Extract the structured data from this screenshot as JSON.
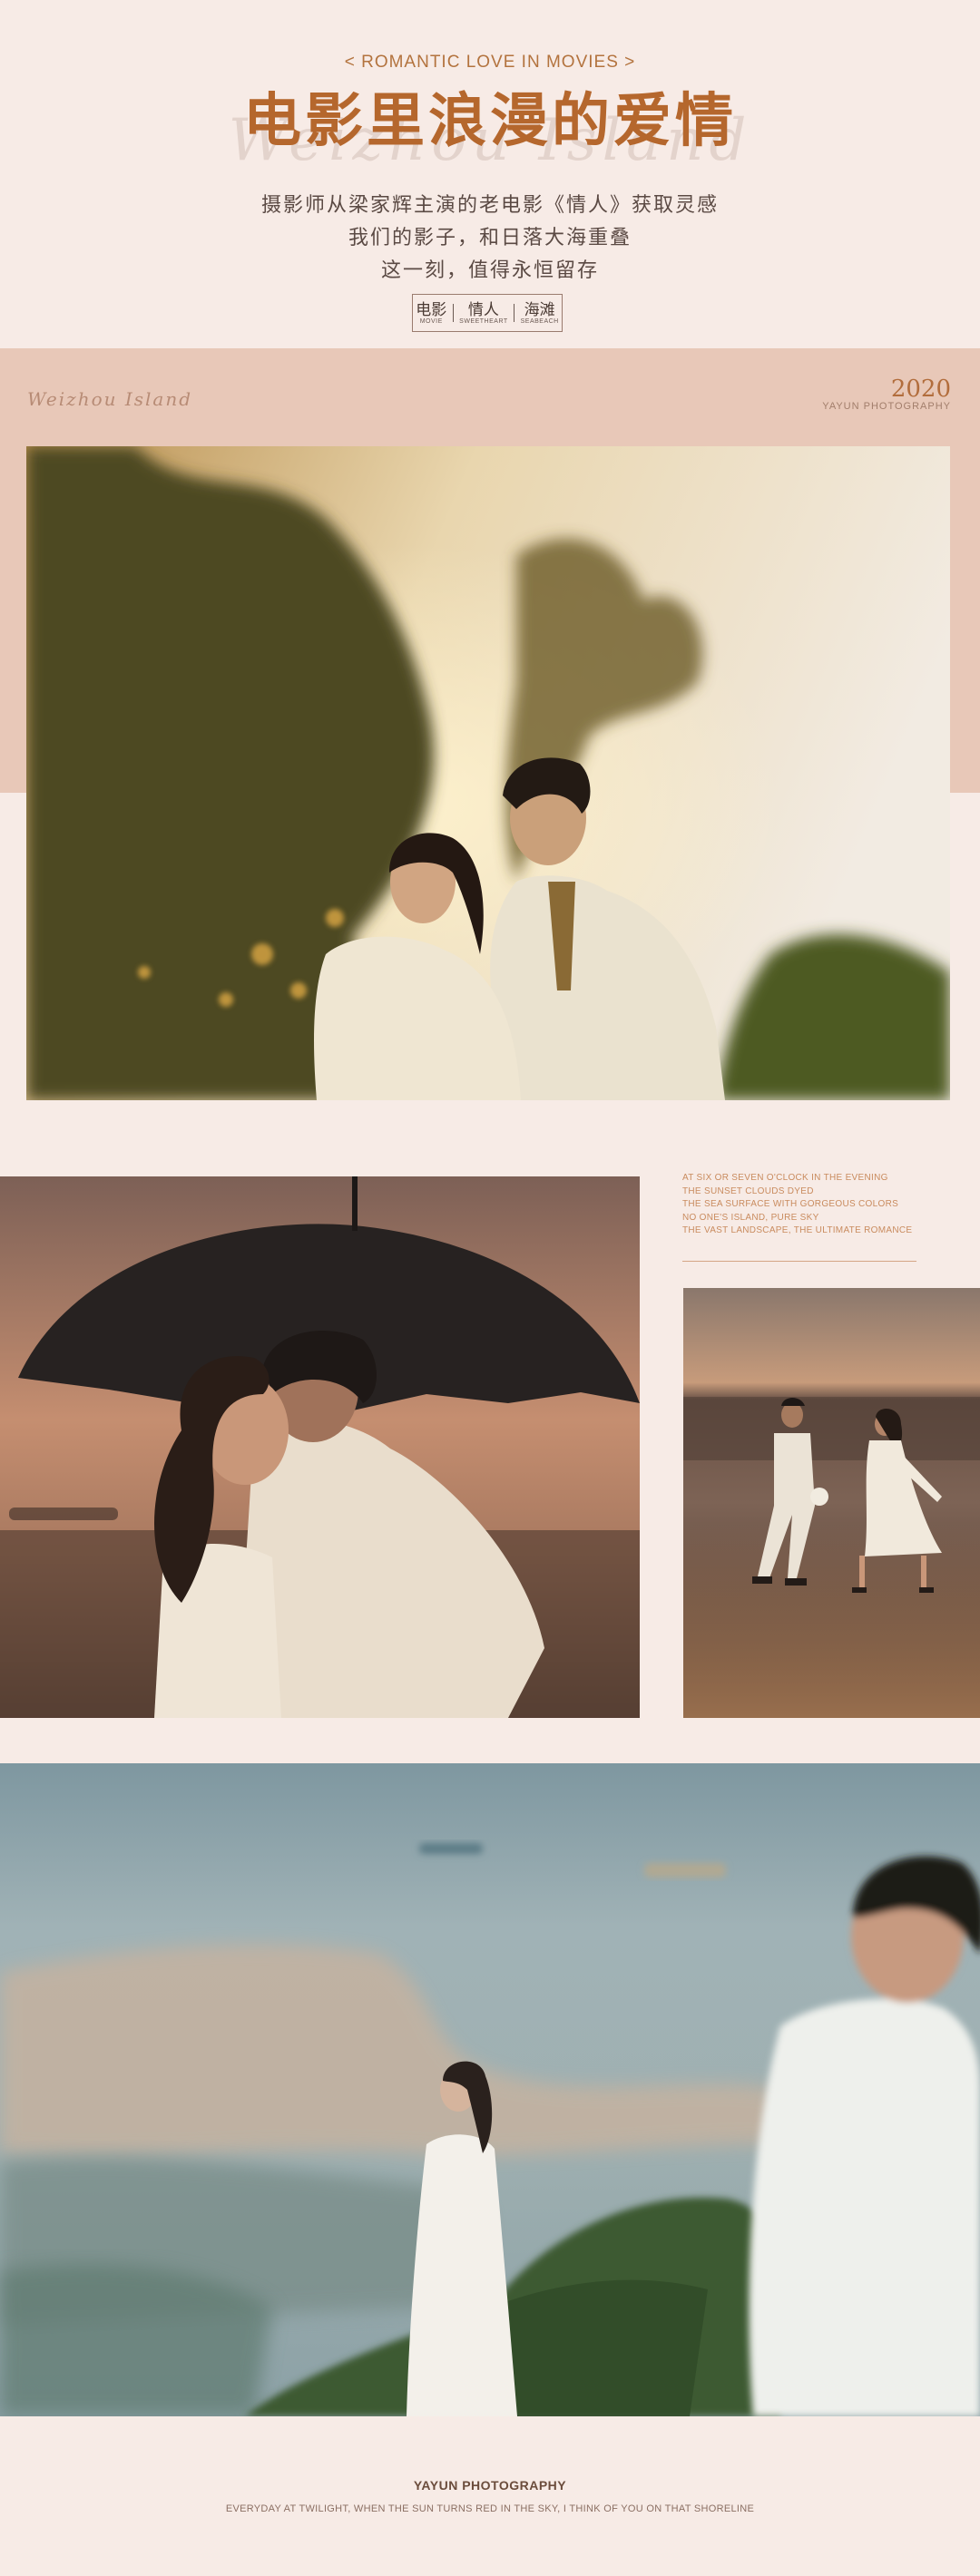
{
  "header": {
    "kicker": "< ROMANTIC LOVE IN MOVIES >",
    "title": "电影里浪漫的爱情",
    "script_text": "Weizhou  Island",
    "intro_lines": [
      "摄影师从梁家辉主演的老电影《情人》获取灵感",
      "我们的影子，和日落大海重叠",
      "这一刻，值得永恒留存"
    ],
    "tags": [
      {
        "cn": "电影",
        "en": "MOVIE"
      },
      {
        "cn": "情人",
        "en": "SWEETHEART"
      },
      {
        "cn": "海滩",
        "en": "SEABEACH"
      }
    ]
  },
  "band": {
    "signature": "Weizhou  Island",
    "year": "2020",
    "studio": "YAYUN PHOTOGRAPHY"
  },
  "poem": {
    "lines": [
      "AT SIX OR SEVEN O'CLOCK IN THE EVENING",
      "THE SUNSET CLOUDS DYED",
      "THE SEA SURFACE WITH GORGEOUS COLORS",
      "NO ONE'S ISLAND, PURE SKY",
      "THE VAST LANDSCAPE, THE ULTIMATE ROMANCE"
    ]
  },
  "footer": {
    "title": "YAYUN PHOTOGRAPHY",
    "subtitle": "EVERYDAY AT TWILIGHT, WHEN THE SUN TURNS RED IN  THE SKY, I THINK OF YOU ON THAT SHORELINE"
  },
  "colors": {
    "background": "#f7ebe6",
    "band": "#e8c8b8",
    "title": "#b5672d",
    "accent": "#c98b5e"
  }
}
